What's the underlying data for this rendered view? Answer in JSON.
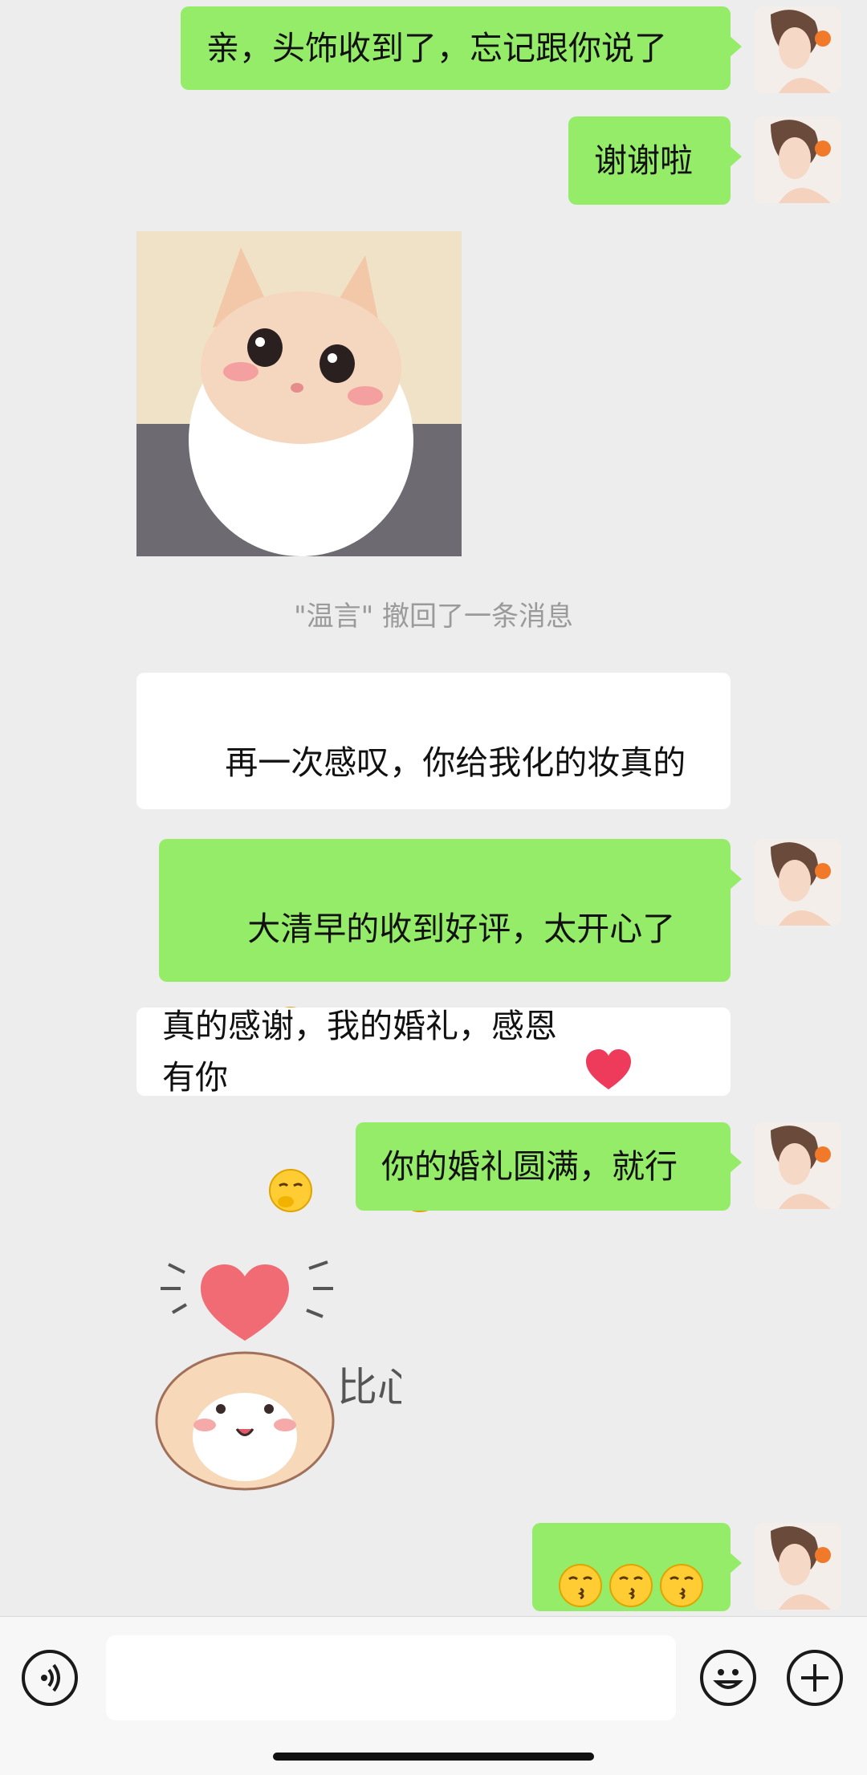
{
  "messages": [
    {
      "side": "right",
      "text": "亲，头饰收到了，忘记跟你说了"
    },
    {
      "side": "right",
      "text": "谢谢啦"
    },
    {
      "side": "left",
      "type": "image",
      "alt": "cat-photo"
    },
    {
      "side": "system",
      "text": "\"温言\" 撤回了一条消息"
    },
    {
      "side": "left",
      "text": "再一次感叹，你给我化的妆真的太好看了"
    },
    {
      "side": "right",
      "text": "大清早的收到好评，太开心了"
    },
    {
      "side": "left",
      "text": "真的感谢，我的婚礼，感恩有你"
    },
    {
      "side": "right",
      "text": "你的婚礼圆满，就行"
    },
    {
      "side": "left",
      "type": "sticker",
      "text": "比心"
    },
    {
      "side": "right",
      "type": "emoji-row",
      "text": ""
    }
  ],
  "composer": {
    "input_placeholder": "",
    "voice_icon": "voice-icon",
    "emoji_icon": "emoji-icon",
    "plus_icon": "plus-icon"
  },
  "colors": {
    "background": "#ededed",
    "bubble_right": "#95ec69",
    "bubble_left": "#ffffff"
  }
}
